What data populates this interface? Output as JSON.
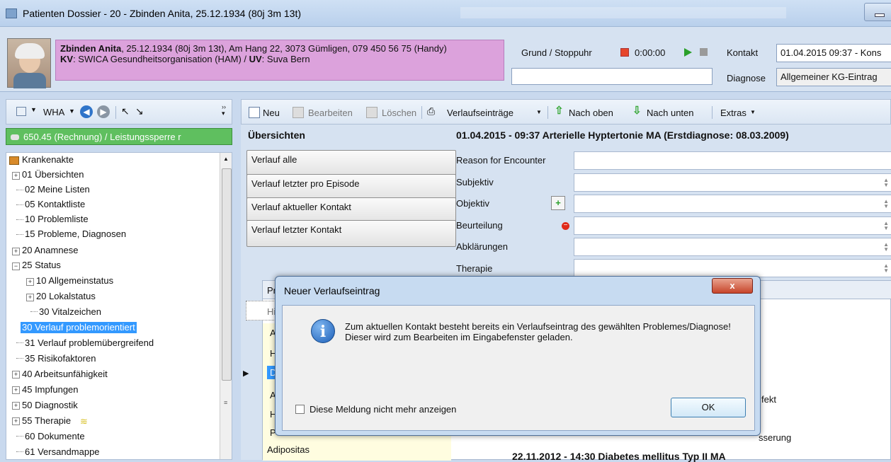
{
  "window": {
    "title": "Patienten Dossier - 20 - Zbinden Anita, 25.12.1934 (80j 3m 13t)"
  },
  "patient": {
    "name": "Zbinden Anita",
    "details": ", 25.12.1934 (80j 3m 13t), Am Hang 22, 3073 Gümligen, 079 450 56 75 (Handy)",
    "kv_label": "KV",
    "kv_value": ": SWICA Gesundheitsorganisation (HAM) / ",
    "uv_label": "UV",
    "uv_value": ": Suva Bern"
  },
  "stopwatch": {
    "label": "Grund / Stoppuhr",
    "time": "0:00:00"
  },
  "kontakt": {
    "label": "Kontakt",
    "value": "01.04.2015 09:37 - Kons"
  },
  "diagnose": {
    "label": "Diagnose",
    "value": "Allgemeiner KG-Eintrag"
  },
  "left_toolbar": {
    "wha": "WHA"
  },
  "rechnung": "650.45 (Rechnung) / Leistungssperre r",
  "tree": [
    {
      "label": "Krankenakte"
    },
    {
      "label": "01 Übersichten"
    },
    {
      "label": "02 Meine Listen"
    },
    {
      "label": "05 Kontaktliste"
    },
    {
      "label": "10 Problemliste"
    },
    {
      "label": "15 Probleme, Diagnosen"
    },
    {
      "label": "20 Anamnese"
    },
    {
      "label": "25 Status"
    },
    {
      "label": "10 Allgemeinstatus"
    },
    {
      "label": "20 Lokalstatus"
    },
    {
      "label": "30 Vitalzeichen"
    },
    {
      "label": "30 Verlauf problemorientiert"
    },
    {
      "label": "31 Verlauf problemübergreifend"
    },
    {
      "label": "35 Risikofaktoren"
    },
    {
      "label": "40 Arbeitsunfähigkeit"
    },
    {
      "label": "45 Impfungen"
    },
    {
      "label": "50 Diagnostik"
    },
    {
      "label": "55 Therapie"
    },
    {
      "label": "60 Dokumente"
    },
    {
      "label": "61 Versandmappe"
    }
  ],
  "toolbar": {
    "neu": "Neu",
    "bearbeiten": "Bearbeiten",
    "loeschen": "Löschen",
    "verlaufseintraege": "Verlaufseinträge",
    "nach_oben": "Nach oben",
    "nach_unten": "Nach unten",
    "extras": "Extras"
  },
  "uebersichten": {
    "heading": "Übersichten",
    "buttons": [
      "Verlauf alle",
      "Verlauf letzter pro Episode",
      "Verlauf aktueller Kontakt",
      "Verlauf letzter Kontakt"
    ]
  },
  "entry": {
    "heading": "01.04.2015 - 09:37 Arterielle Hyptertonie MA (Erstdiagnose: 08.03.2009)",
    "fields": [
      "Reason for Encounter",
      "Subjektiv",
      "Objektiv",
      "Beurteilung",
      "Abklärungen",
      "Therapie"
    ]
  },
  "grid": {
    "col1_header": "Pr",
    "filter": "Hi",
    "rows": [
      "A",
      "H",
      "D",
      "A",
      "H",
      "P",
      "Adipositas"
    ],
    "right_fragments": [
      "fekt",
      "sserung"
    ],
    "bottom_heading": "22.11.2012 - 14:30 Diabetes mellitus Typ II MA"
  },
  "dialog": {
    "title": "Neuer Verlaufseintrag",
    "close": "x",
    "message": "Zum aktuellen Kontakt besteht bereits ein Verlaufseintrag des gewählten Problemes/Diagnose! Dieser wird zum Bearbeiten im Eingabefenster geladen.",
    "checkbox_label": "Diese Meldung nicht mehr anzeigen",
    "ok": "OK"
  }
}
